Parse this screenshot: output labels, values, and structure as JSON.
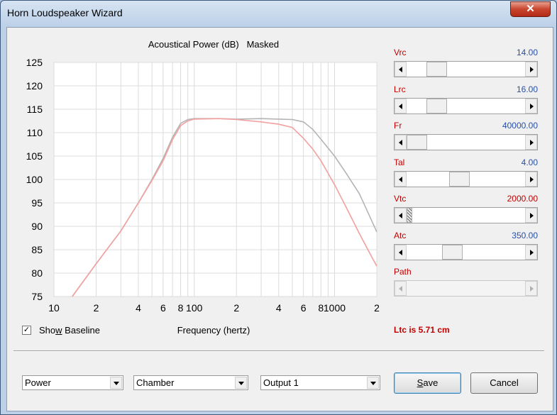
{
  "window": {
    "title": "Horn Loudspeaker Wizard",
    "close_glyph": "✕"
  },
  "chart_data": {
    "type": "line",
    "title": "Acoustical Power (dB)   Masked",
    "xlabel": "Frequency (hertz)",
    "ylabel": "",
    "xscale": "log",
    "xlim": [
      10,
      2000
    ],
    "ylim": [
      75,
      125
    ],
    "yticks": [
      125,
      120,
      115,
      110,
      105,
      100,
      95,
      90,
      85,
      80,
      75
    ],
    "xticks": [
      {
        "value": 10,
        "label": "10"
      },
      {
        "value": 20,
        "label": "2"
      },
      {
        "value": 40,
        "label": "4"
      },
      {
        "value": 60,
        "label": "6"
      },
      {
        "value": 80,
        "label": "8"
      },
      {
        "value": 100,
        "label": "100"
      },
      {
        "value": 200,
        "label": "2"
      },
      {
        "value": 400,
        "label": "4"
      },
      {
        "value": 600,
        "label": "6"
      },
      {
        "value": 800,
        "label": "8"
      },
      {
        "value": 1000,
        "label": "1000"
      },
      {
        "value": 2000,
        "label": "2"
      }
    ],
    "grid": true,
    "series": [
      {
        "color": "#b4b4b4",
        "x": [
          13.5,
          20,
          30,
          40,
          50,
          60,
          70,
          80,
          90,
          100,
          150,
          200,
          300,
          400,
          500,
          600,
          700,
          800,
          1000,
          1200,
          1500,
          1800,
          2000
        ],
        "y": [
          75,
          82,
          89,
          95,
          100,
          104.5,
          109,
          112,
          112.8,
          113,
          113,
          112.9,
          113,
          112.9,
          112.8,
          112.3,
          110.7,
          108.6,
          105,
          101.5,
          97,
          91.8,
          88.8
        ]
      },
      {
        "color": "#f2a0a0",
        "x": [
          13.5,
          20,
          30,
          40,
          50,
          60,
          70,
          80,
          90,
          100,
          150,
          200,
          300,
          400,
          500,
          600,
          700,
          800,
          1000,
          1200,
          1500,
          1800,
          2000
        ],
        "y": [
          75,
          82,
          89,
          95,
          99.8,
          104,
          108.5,
          111.5,
          112.5,
          112.9,
          113,
          112.8,
          112.3,
          111.8,
          111.1,
          108.8,
          106.5,
          104,
          98.9,
          94.3,
          88.5,
          84,
          81.5
        ]
      }
    ]
  },
  "params": [
    {
      "name": "Vrc",
      "value": "14.00",
      "position": 0.2
    },
    {
      "name": "Lrc",
      "value": "16.00",
      "position": 0.2
    },
    {
      "name": "Fr",
      "value": "40000.00",
      "position": 0.0
    },
    {
      "name": "Tal",
      "value": "4.00",
      "position": 0.43
    },
    {
      "name": "Vtc",
      "value": "2000.00",
      "position": 0.0
    },
    {
      "name": "Atc",
      "value": "350.00",
      "position": 0.36
    },
    {
      "name": "Path",
      "value": "",
      "position": 0.0
    }
  ],
  "show_baseline": {
    "label_pre": "Sho",
    "label_key": "w",
    "label_post": " Baseline",
    "checked": true,
    "check_glyph": "✓"
  },
  "ltc_text": "Ltc is 5.71 cm",
  "combos": {
    "mode": "Power",
    "location": "Chamber",
    "output": "Output 1"
  },
  "buttons": {
    "save_key": "S",
    "save_rest": "ave",
    "cancel": "Cancel"
  },
  "colors": {
    "param_name": "#c00000",
    "param_value": "#2850a8",
    "param_value_alert": "#c00000"
  }
}
